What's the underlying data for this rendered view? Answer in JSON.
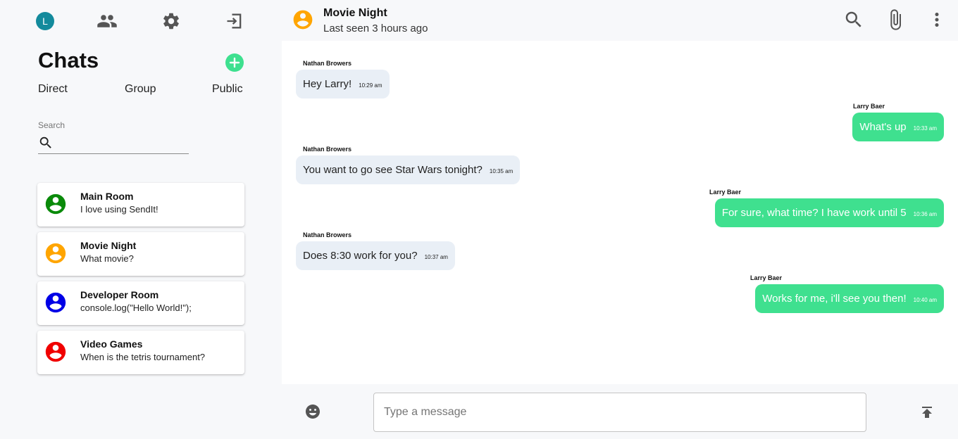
{
  "user": {
    "initial": "L"
  },
  "sidebar": {
    "title": "Chats",
    "tabs": [
      "Direct",
      "Group",
      "Public"
    ],
    "search": {
      "label": "Search",
      "value": ""
    },
    "rooms": [
      {
        "name": "Main Room",
        "last_message": "I love using SendIt!",
        "color": "#0a8a0a"
      },
      {
        "name": "Movie Night",
        "last_message": "What movie?",
        "color": "#ffa500"
      },
      {
        "name": "Developer Room",
        "last_message": "console.log(\"Hello World!\");",
        "color": "#0000e6"
      },
      {
        "name": "Video Games",
        "last_message": "When is the tetris tournament?",
        "color": "#f00000"
      }
    ]
  },
  "chat": {
    "title": "Movie Night",
    "status": "Last seen 3 hours ago",
    "avatar_color": "#ffa500",
    "messages": [
      {
        "sender": "Nathan Browers",
        "text": "Hey Larry!",
        "time": "10:29 am",
        "direction": "in"
      },
      {
        "sender": "Larry Baer",
        "text": "What's up",
        "time": "10:33 am",
        "direction": "out"
      },
      {
        "sender": "Nathan Browers",
        "text": "You want to go see Star Wars tonight?",
        "time": "10:35 am",
        "direction": "in"
      },
      {
        "sender": "Larry Baer",
        "text": "For sure, what time? I have work until 5",
        "time": "10:36 am",
        "direction": "out"
      },
      {
        "sender": "Nathan Browers",
        "text": "Does 8:30 work for you?",
        "time": "10:37 am",
        "direction": "in"
      },
      {
        "sender": "Larry Baer",
        "text": "Works for me, i'll see you then!",
        "time": "10:40 am",
        "direction": "out"
      }
    ]
  },
  "composer": {
    "placeholder": "Type a message",
    "value": ""
  },
  "colors": {
    "accent": "#3ee08f",
    "incoming_bubble": "#e9eff6",
    "user_avatar": "#138a9c",
    "icon_gray": "#555555"
  },
  "icons": {
    "nav": [
      "user-avatar",
      "contacts-icon",
      "settings-icon",
      "logout-icon"
    ],
    "header": [
      "search-icon",
      "attach-icon",
      "more-vert-icon"
    ],
    "composer": [
      "emoji-icon",
      "send-icon"
    ]
  }
}
